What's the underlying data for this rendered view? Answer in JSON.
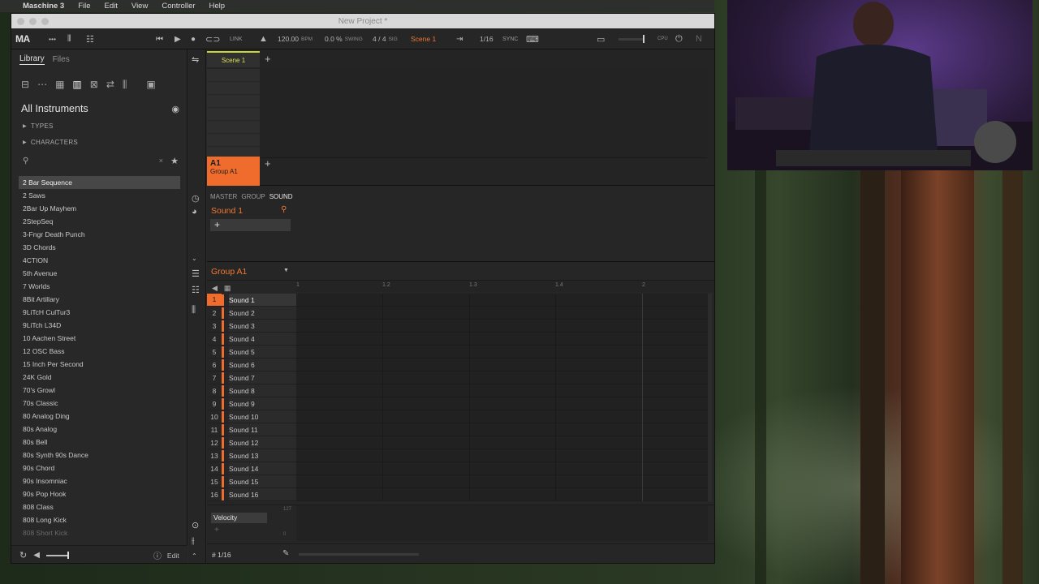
{
  "menubar": {
    "app_name": "Maschine 3",
    "items": [
      "File",
      "Edit",
      "View",
      "Controller",
      "Help"
    ]
  },
  "window": {
    "title": "New Project *"
  },
  "toolbar": {
    "logo": "MA",
    "link_label": "LINK",
    "tempo": "120.00",
    "tempo_unit": "BPM",
    "swing": "0.0 %",
    "swing_label": "SWING",
    "sig_num": "4",
    "sig_sep": "/",
    "sig_den": "4",
    "sig_label": "SIG",
    "scene": "Scene 1",
    "grid": "1/16",
    "sync_label": "SYNC",
    "cpu_label": "CPU"
  },
  "sidebar": {
    "tabs": [
      "Library",
      "Files"
    ],
    "heading": "All Instruments",
    "categories": [
      "TYPES",
      "CHARACTERS"
    ],
    "search_placeholder": "",
    "items": [
      "2 Bar Sequence",
      "2 Saws",
      "2Bar Up Mayhem",
      "2StepSeq",
      "3-Fngr Death Punch",
      "3D Chords",
      "4CTION",
      "5th Avenue",
      "7 Worlds",
      "8Bit Artillary",
      "9LiTcH CulTur3",
      "9LiTch L34D",
      "10 Aachen Street",
      "12 OSC Bass",
      "15 Inch Per Second",
      "24K Gold",
      "70's Growl",
      "70s Classic",
      "80 Analog Ding",
      "80s Analog",
      "80s Bell",
      "80s Synth 90s Dance",
      "90s Chord",
      "90s Insomniac",
      "90s Pop Hook",
      "808 Class",
      "808 Long Kick",
      "808 Short Kick"
    ],
    "selected_index": 0,
    "footer_edit": "Edit"
  },
  "arranger": {
    "scene_tab": "Scene 1",
    "group_name": "A1",
    "group_sub": "Group A1"
  },
  "sound_panel": {
    "tabs": [
      "MASTER",
      "GROUP",
      "SOUND"
    ],
    "active_tab": "SOUND",
    "sound_name": "Sound 1"
  },
  "editor": {
    "group_name": "Group A1",
    "ruler": [
      "1",
      "1.2",
      "1.3",
      "1.4",
      "2"
    ],
    "sounds": [
      {
        "num": "1",
        "name": "Sound 1"
      },
      {
        "num": "2",
        "name": "Sound 2"
      },
      {
        "num": "3",
        "name": "Sound 3"
      },
      {
        "num": "4",
        "name": "Sound 4"
      },
      {
        "num": "5",
        "name": "Sound 5"
      },
      {
        "num": "6",
        "name": "Sound 6"
      },
      {
        "num": "7",
        "name": "Sound 7"
      },
      {
        "num": "8",
        "name": "Sound 8"
      },
      {
        "num": "9",
        "name": "Sound 9"
      },
      {
        "num": "10",
        "name": "Sound 10"
      },
      {
        "num": "11",
        "name": "Sound 11"
      },
      {
        "num": "12",
        "name": "Sound 12"
      },
      {
        "num": "13",
        "name": "Sound 13"
      },
      {
        "num": "14",
        "name": "Sound 14"
      },
      {
        "num": "15",
        "name": "Sound 15"
      },
      {
        "num": "16",
        "name": "Sound 16"
      }
    ],
    "selected_sound": 0,
    "velocity_label": "Velocity",
    "velocity_max": "127",
    "velocity_min": "0",
    "quantize": "1/16"
  },
  "colors": {
    "accent": "#f06c2c",
    "scene_accent": "#c8d53a"
  }
}
